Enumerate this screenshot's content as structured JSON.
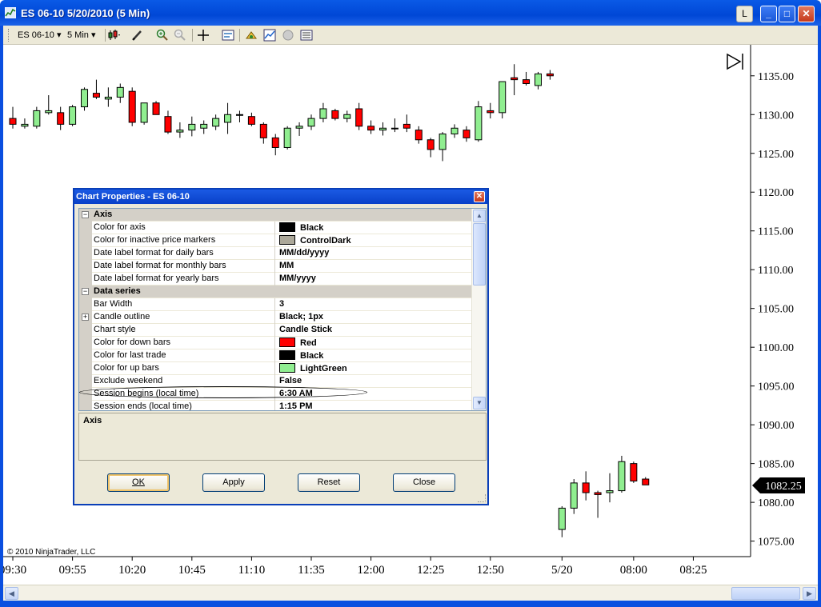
{
  "window": {
    "title": "ES 06-10  5/20/2010 (5 Min)",
    "l_button": "L",
    "min_glyph": "_",
    "max_glyph": "□",
    "close_glyph": "✕"
  },
  "toolbar": {
    "instrument": "ES 06-10",
    "interval": "5 Min",
    "dropdown_glyph": "▾"
  },
  "chart": {
    "copyright": "© 2010 NinjaTrader, LLC",
    "last_price": "1082.25",
    "ylim": [
      1073,
      1139
    ]
  },
  "chart_data": {
    "type": "candlestick",
    "y_ticks": [
      "1135.00",
      "1130.00",
      "1125.00",
      "1120.00",
      "1115.00",
      "1110.00",
      "1105.00",
      "1100.00",
      "1095.00",
      "1090.00",
      "1085.00",
      "1080.00",
      "1075.00"
    ],
    "y_tick_values": [
      1135,
      1130,
      1125,
      1120,
      1115,
      1110,
      1105,
      1100,
      1095,
      1090,
      1085,
      1080,
      1075
    ],
    "x_ticks": [
      {
        "label": "09:30",
        "bar": 0
      },
      {
        "label": "09:55",
        "bar": 5
      },
      {
        "label": "10:20",
        "bar": 10
      },
      {
        "label": "10:45",
        "bar": 15
      },
      {
        "label": "11:10",
        "bar": 20
      },
      {
        "label": "11:35",
        "bar": 25
      },
      {
        "label": "12:00",
        "bar": 30
      },
      {
        "label": "12:25",
        "bar": 35
      },
      {
        "label": "12:50",
        "bar": 40
      },
      {
        "label": "5/20",
        "bar": 46
      },
      {
        "label": "08:00",
        "bar": 52
      },
      {
        "label": "08:25",
        "bar": 57
      }
    ],
    "up_color": "#90ee90",
    "down_color": "#ff0000",
    "bars": [
      [
        1129.5,
        1131,
        1128.2,
        1128.75
      ],
      [
        1128.5,
        1129.5,
        1128.2,
        1128.75
      ],
      [
        1128.5,
        1131,
        1128.2,
        1130.5
      ],
      [
        1130.25,
        1132.5,
        1130,
        1130.5
      ],
      [
        1130.25,
        1131,
        1128,
        1128.75
      ],
      [
        1128.75,
        1131.25,
        1128.5,
        1131
      ],
      [
        1131,
        1133.5,
        1130.5,
        1133.25
      ],
      [
        1132.75,
        1134.5,
        1132,
        1132.25
      ],
      [
        1132,
        1133.5,
        1131,
        1132.25
      ],
      [
        1132.25,
        1134,
        1131.5,
        1133.5
      ],
      [
        1133,
        1133.5,
        1128.5,
        1129
      ],
      [
        1129,
        1131.5,
        1128.7,
        1131.5
      ],
      [
        1131.5,
        1131.75,
        1130,
        1130
      ],
      [
        1129.75,
        1130.5,
        1127.5,
        1127.75
      ],
      [
        1127.75,
        1129,
        1127,
        1128
      ],
      [
        1128,
        1129.75,
        1127.2,
        1128.75
      ],
      [
        1128.25,
        1129.25,
        1127.5,
        1128.75
      ],
      [
        1128.5,
        1130,
        1128,
        1129.5
      ],
      [
        1129,
        1131.5,
        1127.5,
        1130
      ],
      [
        1130,
        1130.5,
        1129,
        1130
      ],
      [
        1129.75,
        1130.25,
        1128.5,
        1128.75
      ],
      [
        1128.75,
        1129,
        1126.25,
        1127
      ],
      [
        1127,
        1127.5,
        1124.75,
        1125.75
      ],
      [
        1125.75,
        1128.5,
        1125.5,
        1128.25
      ],
      [
        1128.25,
        1129,
        1127.25,
        1128.5
      ],
      [
        1128.5,
        1130,
        1128,
        1129.5
      ],
      [
        1129.5,
        1131.5,
        1129,
        1130.75
      ],
      [
        1130.5,
        1130.75,
        1129.25,
        1129.5
      ],
      [
        1129.5,
        1130.5,
        1129,
        1130
      ],
      [
        1130.75,
        1131.5,
        1128,
        1128.5
      ],
      [
        1128.5,
        1129.25,
        1127.5,
        1128
      ],
      [
        1128,
        1129,
        1127.3,
        1128.25
      ],
      [
        1128.25,
        1129.5,
        1127.75,
        1128.25
      ],
      [
        1128.75,
        1130,
        1127.75,
        1128.25
      ],
      [
        1128,
        1128.5,
        1126.25,
        1126.75
      ],
      [
        1126.75,
        1127,
        1124.5,
        1125.5
      ],
      [
        1125.5,
        1127.75,
        1124,
        1127.5
      ],
      [
        1127.5,
        1128.75,
        1127,
        1128.25
      ],
      [
        1128,
        1128.5,
        1126.5,
        1127
      ],
      [
        1126.75,
        1131.75,
        1126.5,
        1131
      ],
      [
        1130.5,
        1131.5,
        1129.5,
        1130.25
      ],
      [
        1130.25,
        1134.25,
        1129.5,
        1134.25
      ],
      [
        1134.75,
        1136.5,
        1132.5,
        1134.5
      ],
      [
        1134.5,
        1135.5,
        1133.75,
        1134
      ],
      [
        1133.75,
        1135.5,
        1133.25,
        1135.25
      ],
      [
        1135.25,
        1135.75,
        1134.5,
        1135
      ],
      [
        1076.5,
        1079.5,
        1075.5,
        1079.25
      ],
      [
        1079.25,
        1083,
        1078.5,
        1082.5
      ],
      [
        1082.5,
        1084,
        1080.25,
        1081.25
      ],
      [
        1081.25,
        1081.5,
        1078,
        1081
      ],
      [
        1081.25,
        1083.75,
        1080,
        1081.5
      ],
      [
        1081.5,
        1086,
        1081.25,
        1085.25
      ],
      [
        1085,
        1085.25,
        1082.5,
        1082.75
      ],
      [
        1083,
        1083.25,
        1082.25,
        1082.25
      ]
    ]
  },
  "dialog": {
    "title": "Chart Properties - ES 06-10",
    "close_glyph": "✕",
    "collapse_glyph": "−",
    "expand_glyph": "+",
    "rows": [
      {
        "type": "category",
        "name": "Axis"
      },
      {
        "type": "prop",
        "name": "Color for axis",
        "value": "Black",
        "swatch": "#000000"
      },
      {
        "type": "prop",
        "name": "Color for inactive price markers",
        "value": "ControlDark",
        "swatch": "#aca899"
      },
      {
        "type": "prop",
        "name": "Date label format for daily bars",
        "value": "MM/dd/yyyy"
      },
      {
        "type": "prop",
        "name": "Date label format for monthly bars",
        "value": "MM"
      },
      {
        "type": "prop",
        "name": "Date label format for yearly bars",
        "value": "MM/yyyy"
      },
      {
        "type": "category",
        "name": "Data series"
      },
      {
        "type": "prop",
        "name": "Bar Width",
        "value": "3"
      },
      {
        "type": "prop",
        "name": "Candle outline",
        "value": "Black; 1px",
        "expandable": true
      },
      {
        "type": "prop",
        "name": "Chart style",
        "value": "Candle Stick"
      },
      {
        "type": "prop",
        "name": "Color for down bars",
        "value": "Red",
        "swatch": "#ff0000"
      },
      {
        "type": "prop",
        "name": "Color for last trade",
        "value": "Black",
        "swatch": "#000000"
      },
      {
        "type": "prop",
        "name": "Color for up bars",
        "value": "LightGreen",
        "swatch": "#90ee90"
      },
      {
        "type": "prop",
        "name": "Exclude weekend",
        "value": "False"
      },
      {
        "type": "prop",
        "name": "Session begins (local time)",
        "value": "6:30 AM"
      },
      {
        "type": "prop",
        "name": "Session ends (local time)",
        "value": "1:15 PM"
      }
    ],
    "description_title": "Axis",
    "buttons": {
      "ok": "OK",
      "apply": "Apply",
      "reset": "Reset",
      "close": "Close"
    },
    "scroll_up": "▲",
    "scroll_down": "▼"
  },
  "hscroll": {
    "left": "◀",
    "right": "▶"
  }
}
